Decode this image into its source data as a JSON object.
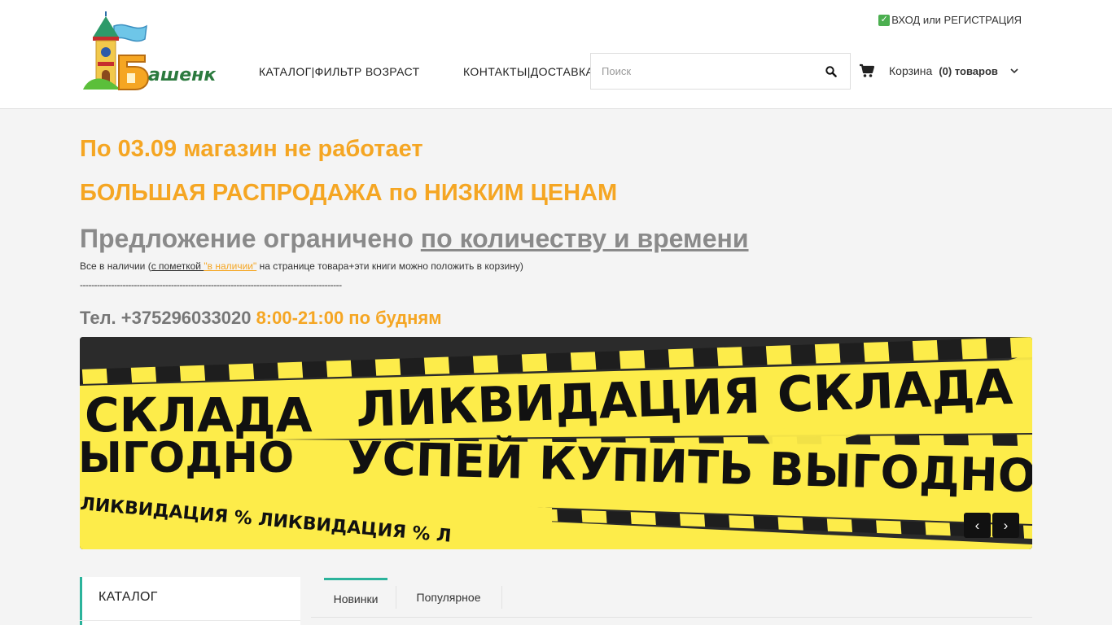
{
  "header": {
    "logo_alt": "logo",
    "login_label": "ВХОД или РЕГИСТРАЦИЯ",
    "nav": [
      {
        "label": "КАТАЛОГ|ФИЛЬТР ВОЗРАСТ"
      },
      {
        "label": "КОНТАКТЫ|ДОСТАВКА"
      }
    ],
    "search": {
      "placeholder": "Поиск",
      "value": ""
    },
    "cart": {
      "label": "Корзина",
      "count": "(0) товаров"
    }
  },
  "notice": {
    "line1": "По 03.09 магазин не работает",
    "line2": "БОЛЬШАЯ РАСПРОДАЖА по НИЗКИМ ЦЕНАМ",
    "line3_plain": "Предложение ограничено ",
    "line3_underlined": "по количеству и времени",
    "note_prefix": "Все в наличии (",
    "note_link1": "с пометкой ",
    "note_link2": "\"в наличии\"",
    "note_suffix": " на странице товара+эти книги можно положить в корзину)",
    "dashes": "--------------------------------------------------------------------------------------------",
    "phone_gray": "Тел. +375296033020 ",
    "phone_orange": "8:00-21:00 по будням"
  },
  "banner": {
    "text_top_left": "СКЛАДА",
    "text_top": "ЛИКВИДАЦИЯ СКЛАДА",
    "text_mid_left": "ЫГОДНО",
    "text_mid": "УСПЕЙ КУПИТЬ ВЫГОДНО",
    "text_bottom": "ЛИКВИДАЦИЯ % ЛИКВИДАЦИЯ % Л",
    "prev": "‹",
    "next": "›",
    "colors": {
      "yellow": "#fdec4a",
      "dark": "#2b2b2b"
    }
  },
  "sidebar": {
    "catalog_title": "КАТАЛОГ"
  },
  "tabs": [
    {
      "label": "Новинки",
      "active": true
    },
    {
      "label": "Популярное",
      "active": false
    }
  ],
  "colors": {
    "accent": "#f5a623",
    "teal": "#2bb39b"
  }
}
